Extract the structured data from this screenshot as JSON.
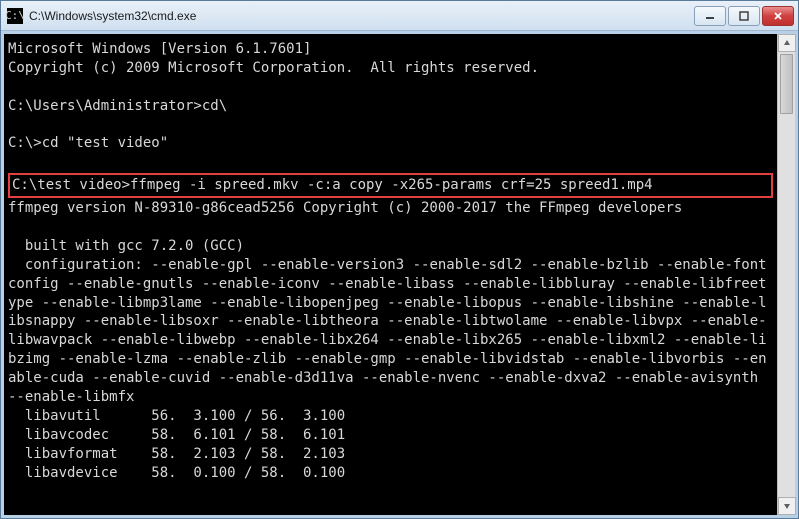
{
  "titlebar": {
    "icon_label": "C:\\",
    "title": "C:\\Windows\\system32\\cmd.exe"
  },
  "console": {
    "line1": "Microsoft Windows [Version 6.1.7601]",
    "line2": "Copyright (c) 2009 Microsoft Corporation.  All rights reserved.",
    "blank": "",
    "line3": "C:\\Users\\Administrator>cd\\",
    "line4": "C:\\>cd \"test video\"",
    "highlighted": "C:\\test video>ffmpeg -i spreed.mkv -c:a copy -x265-params crf=25 spreed1.mp4",
    "line5": "ffmpeg version N-89310-g86cead5256 Copyright (c) 2000-2017 the FFmpeg developers",
    "line6": "  built with gcc 7.2.0 (GCC)",
    "config": "  configuration: --enable-gpl --enable-version3 --enable-sdl2 --enable-bzlib --enable-fontconfig --enable-gnutls --enable-iconv --enable-libass --enable-libbluray --enable-libfreetype --enable-libmp3lame --enable-libopenjpeg --enable-libopus --enable-libshine --enable-libsnappy --enable-libsoxr --enable-libtheora --enable-libtwolame --enable-libvpx --enable-libwavpack --enable-libwebp --enable-libx264 --enable-libx265 --enable-libxml2 --enable-libzimg --enable-lzma --enable-zlib --enable-gmp --enable-libvidstab --enable-libvorbis --enable-cuda --enable-cuvid --enable-d3d11va --enable-nvenc --enable-dxva2 --enable-avisynth --enable-libmfx",
    "lib1": "  libavutil      56.  3.100 / 56.  3.100",
    "lib2": "  libavcodec     58.  6.101 / 58.  6.101",
    "lib3": "  libavformat    58.  2.103 / 58.  2.103",
    "lib4": "  libavdevice    58.  0.100 / 58.  0.100"
  },
  "colors": {
    "highlight_border": "#e04040",
    "console_bg": "#000000",
    "console_fg": "#d8d8d8"
  }
}
